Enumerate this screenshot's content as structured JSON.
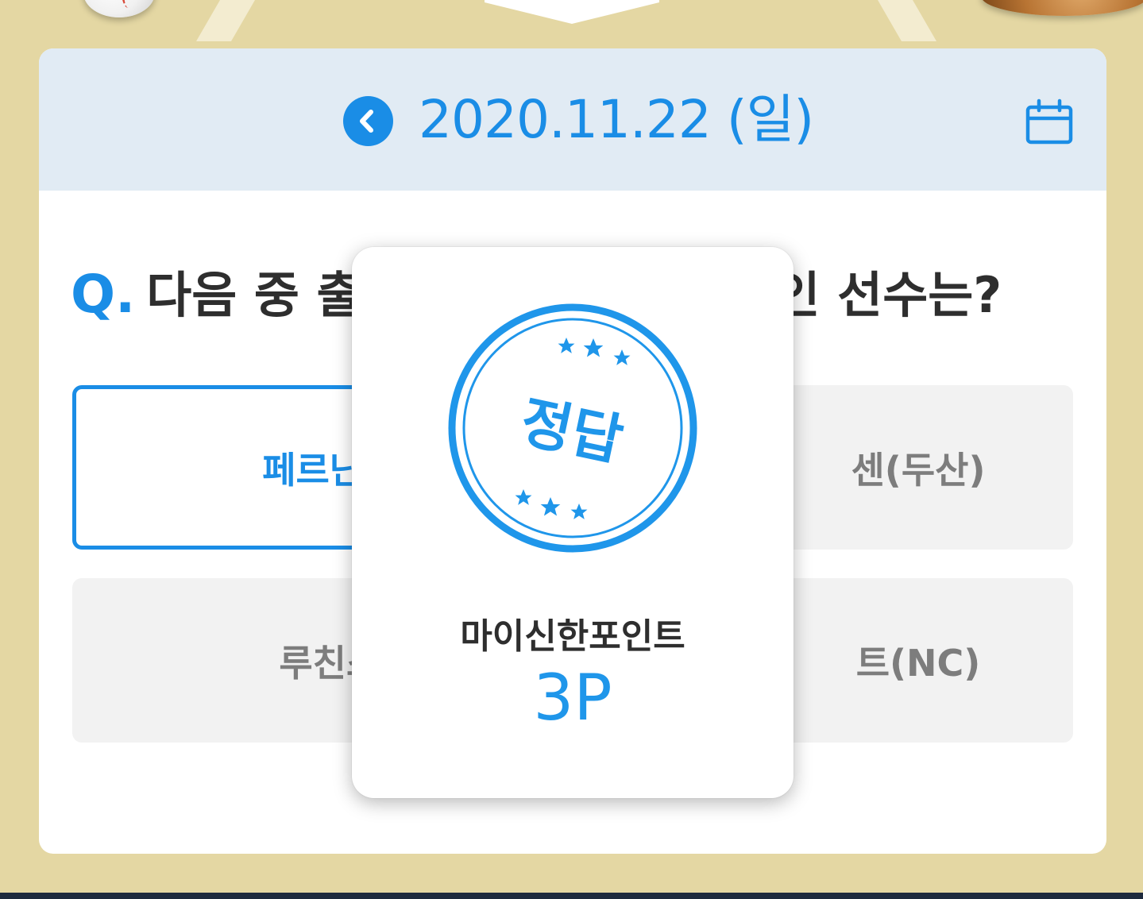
{
  "date_bar": {
    "date": "2020.11.22 (일)",
    "prev_icon": "chevron-left-icon",
    "calendar_icon": "calendar-icon",
    "accent_color": "#1a8de6",
    "background_color": "#e1ebf4"
  },
  "question": {
    "prefix": "Q.",
    "left_text": "다음 중 출",
    "right_text": "인 선수는?"
  },
  "options": [
    {
      "label": "페르난데스",
      "selected": true
    },
    {
      "label": "센(두산)",
      "selected": false
    },
    {
      "label": "루친스키",
      "selected": false
    },
    {
      "label": "트(NC)",
      "selected": false
    }
  ],
  "popup": {
    "stamp_text": "정답",
    "reward_label": "마이신한포인트",
    "reward_value": "3P",
    "stamp_color": "#1f96ea"
  }
}
